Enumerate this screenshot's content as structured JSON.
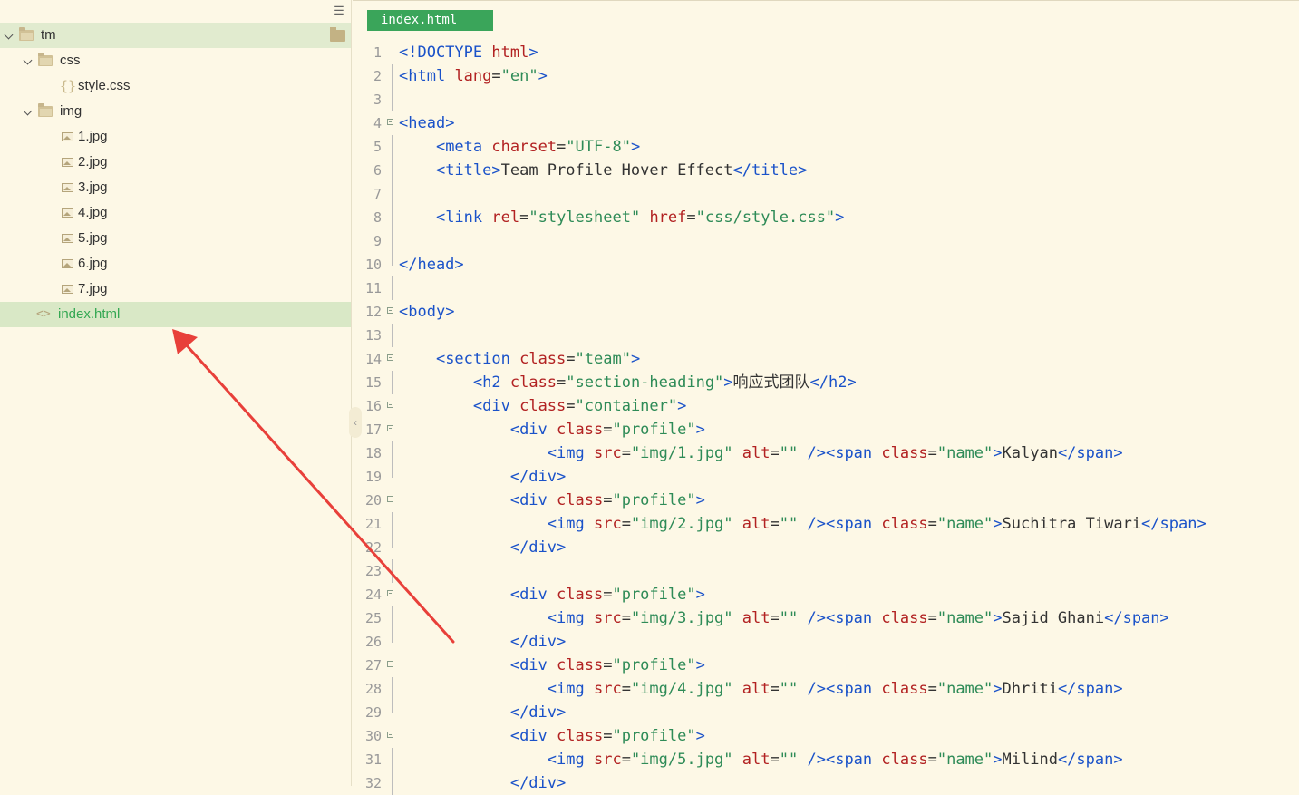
{
  "sidebar": {
    "tree": [
      {
        "label": "tm",
        "kind": "root"
      },
      {
        "label": "css",
        "kind": "folder"
      },
      {
        "label": "style.css",
        "kind": "css-file"
      },
      {
        "label": "img",
        "kind": "folder"
      },
      {
        "label": "1.jpg",
        "kind": "image"
      },
      {
        "label": "2.jpg",
        "kind": "image"
      },
      {
        "label": "3.jpg",
        "kind": "image"
      },
      {
        "label": "4.jpg",
        "kind": "image"
      },
      {
        "label": "5.jpg",
        "kind": "image"
      },
      {
        "label": "6.jpg",
        "kind": "image"
      },
      {
        "label": "7.jpg",
        "kind": "image"
      },
      {
        "label": "index.html",
        "kind": "html",
        "selected": true
      }
    ]
  },
  "editor": {
    "tab": "index.html",
    "lines": [
      {
        "n": "1",
        "text": "<!DOCTYPE html>"
      },
      {
        "n": "2",
        "text": "<html lang=\"en\">"
      },
      {
        "n": "3",
        "text": ""
      },
      {
        "n": "4",
        "text": "<head>"
      },
      {
        "n": "5",
        "text": "    <meta charset=\"UTF-8\">"
      },
      {
        "n": "6",
        "text": "    <title>Team Profile Hover Effect</title>"
      },
      {
        "n": "7",
        "text": ""
      },
      {
        "n": "8",
        "text": "    <link rel=\"stylesheet\" href=\"css/style.css\">"
      },
      {
        "n": "9",
        "text": ""
      },
      {
        "n": "10",
        "text": "</head>"
      },
      {
        "n": "11",
        "text": ""
      },
      {
        "n": "12",
        "text": "<body>"
      },
      {
        "n": "13",
        "text": ""
      },
      {
        "n": "14",
        "text": "    <section class=\"team\">"
      },
      {
        "n": "15",
        "text": "        <h2 class=\"section-heading\">响应式团队</h2>"
      },
      {
        "n": "16",
        "text": "        <div class=\"container\">"
      },
      {
        "n": "17",
        "text": "            <div class=\"profile\">"
      },
      {
        "n": "18",
        "text": "                <img src=\"img/1.jpg\" alt=\"\" /><span class=\"name\">Kalyan</span>"
      },
      {
        "n": "19",
        "text": "            </div>"
      },
      {
        "n": "20",
        "text": "            <div class=\"profile\">"
      },
      {
        "n": "21",
        "text": "                <img src=\"img/2.jpg\" alt=\"\" /><span class=\"name\">Suchitra Tiwari</span>"
      },
      {
        "n": "22",
        "text": "            </div>"
      },
      {
        "n": "23",
        "text": ""
      },
      {
        "n": "24",
        "text": "            <div class=\"profile\">"
      },
      {
        "n": "25",
        "text": "                <img src=\"img/3.jpg\" alt=\"\" /><span class=\"name\">Sajid Ghani</span>"
      },
      {
        "n": "26",
        "text": "            </div>"
      },
      {
        "n": "27",
        "text": "            <div class=\"profile\">"
      },
      {
        "n": "28",
        "text": "                <img src=\"img/4.jpg\" alt=\"\" /><span class=\"name\">Dhriti</span>"
      },
      {
        "n": "29",
        "text": "            </div>"
      },
      {
        "n": "30",
        "text": "            <div class=\"profile\">"
      },
      {
        "n": "31",
        "text": "                <img src=\"img/5.jpg\" alt=\"\" /><span class=\"name\">Milind</span>"
      },
      {
        "n": "32",
        "text": "            </div>"
      }
    ],
    "folds": [
      "4",
      "12",
      "14",
      "16",
      "17",
      "20",
      "24",
      "27",
      "30"
    ],
    "fold_ends": [
      "10",
      "19",
      "22",
      "26",
      "29"
    ]
  },
  "colors": {
    "accent": "#3aa55a",
    "tag": "#1a52c9",
    "attr": "#b22222",
    "string": "#2e8b57",
    "arrow": "#e8403a"
  }
}
